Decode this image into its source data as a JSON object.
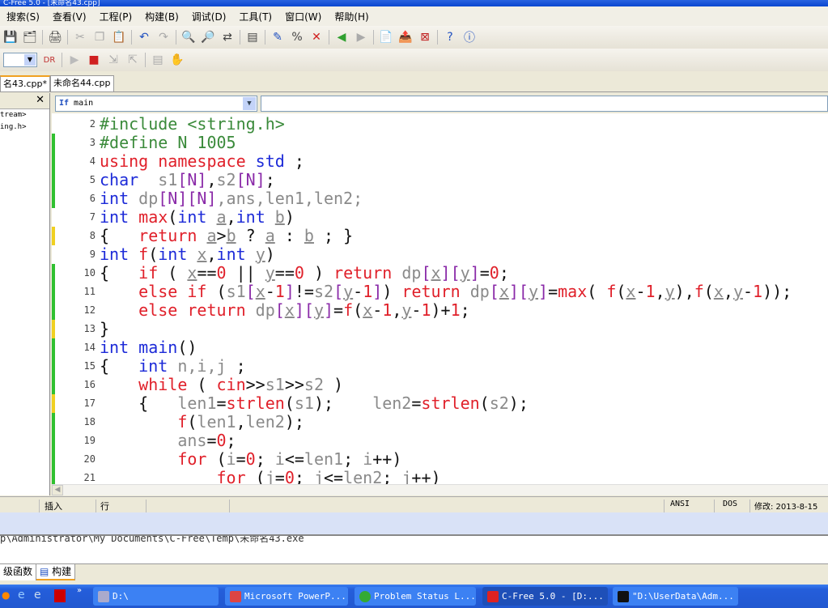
{
  "window": {
    "title": "C-Free 5.0 - [未命名43.cpp]"
  },
  "menu": [
    "搜索(S)",
    "查看(V)",
    "工程(P)",
    "构建(B)",
    "调试(D)",
    "工具(T)",
    "窗口(W)",
    "帮助(H)"
  ],
  "toolbar1": [
    "save-icon",
    "save-all-icon",
    "print-icon",
    "cut-icon",
    "copy-icon",
    "paste-icon",
    "undo-icon",
    "redo-icon",
    "find-icon",
    "find-next-icon",
    "replace-icon",
    "bookmark-icon",
    "compile-icon",
    "run-icon",
    "stop-build-icon",
    "back-icon",
    "forward-icon",
    "file-icon",
    "export-icon",
    "close-file-icon",
    "help-icon",
    "info-icon"
  ],
  "toolbar2": [
    "dropdown",
    "debug-run-icon",
    "play-icon",
    "stop-icon",
    "step-icon",
    "step-over-icon",
    "watch-icon",
    "hand-icon"
  ],
  "tabs": [
    {
      "label": "名43.cpp*",
      "active": true
    },
    {
      "label": "未命名44.cpp",
      "active": false
    }
  ],
  "left_panel": {
    "items": [
      "tream>",
      "ing.h>"
    ]
  },
  "function_selector": {
    "icon": "If",
    "value": "main"
  },
  "editor": {
    "lines": [
      {
        "n": "2",
        "mark": "",
        "t": [
          [
            "#include <string.h>",
            "g"
          ]
        ]
      },
      {
        "n": "3",
        "mark": "green",
        "t": [
          [
            "#define N 1005",
            "g"
          ]
        ]
      },
      {
        "n": "4",
        "mark": "green",
        "t": [
          [
            "using namespace",
            "r"
          ],
          [
            " std",
            "k"
          ],
          [
            " ;",
            "o"
          ]
        ]
      },
      {
        "n": "5",
        "mark": "green",
        "t": [
          [
            "char",
            "k"
          ],
          [
            "  s1",
            "v"
          ],
          [
            "[N]",
            "p"
          ],
          [
            ",",
            "o"
          ],
          [
            "s2",
            "v"
          ],
          [
            "[N]",
            "p"
          ],
          [
            ";",
            "o"
          ]
        ]
      },
      {
        "n": "6",
        "mark": "green",
        "t": [
          [
            "int",
            "k"
          ],
          [
            " dp",
            "v"
          ],
          [
            "[N][N]",
            "p"
          ],
          [
            ",ans,len1,len2;",
            "v"
          ]
        ]
      },
      {
        "n": "7",
        "mark": "",
        "t": [
          [
            "int",
            "k"
          ],
          [
            " max",
            "r"
          ],
          [
            "(",
            "o"
          ],
          [
            "int",
            "k"
          ],
          [
            " ",
            "o"
          ],
          [
            "a",
            "u"
          ],
          [
            ",",
            "o"
          ],
          [
            "int",
            "k"
          ],
          [
            " ",
            "o"
          ],
          [
            "b",
            "u"
          ],
          [
            ")",
            "o"
          ]
        ]
      },
      {
        "n": "8",
        "mark": "yellow",
        "t": [
          [
            "{   ",
            "o"
          ],
          [
            "return",
            "r"
          ],
          [
            " ",
            "o"
          ],
          [
            "a",
            "u"
          ],
          [
            ">",
            "o"
          ],
          [
            "b",
            "u"
          ],
          [
            " ? ",
            "o"
          ],
          [
            "a",
            "u"
          ],
          [
            " : ",
            "o"
          ],
          [
            "b",
            "u"
          ],
          [
            " ; }",
            "o"
          ]
        ]
      },
      {
        "n": "9",
        "mark": "",
        "t": [
          [
            "int",
            "k"
          ],
          [
            " f",
            "r"
          ],
          [
            "(",
            "o"
          ],
          [
            "int",
            "k"
          ],
          [
            " ",
            "o"
          ],
          [
            "x",
            "u"
          ],
          [
            ",",
            "o"
          ],
          [
            "int",
            "k"
          ],
          [
            " ",
            "o"
          ],
          [
            "y",
            "u"
          ],
          [
            ")",
            "o"
          ]
        ]
      },
      {
        "n": "10",
        "mark": "green",
        "t": [
          [
            "{   ",
            "o"
          ],
          [
            "if",
            "r"
          ],
          [
            " ( ",
            "o"
          ],
          [
            "x",
            "u"
          ],
          [
            "==",
            "o"
          ],
          [
            "0",
            "n"
          ],
          [
            " || ",
            "o"
          ],
          [
            "y",
            "u"
          ],
          [
            "==",
            "o"
          ],
          [
            "0",
            "n"
          ],
          [
            " ) ",
            "o"
          ],
          [
            "return",
            "r"
          ],
          [
            " dp",
            "v"
          ],
          [
            "[",
            "p"
          ],
          [
            "x",
            "u"
          ],
          [
            "][",
            "p"
          ],
          [
            "y",
            "u"
          ],
          [
            "]",
            "p"
          ],
          [
            "=",
            "o"
          ],
          [
            "0",
            "n"
          ],
          [
            ";",
            "o"
          ]
        ]
      },
      {
        "n": "11",
        "mark": "green",
        "t": [
          [
            "    ",
            "o"
          ],
          [
            "else if",
            "r"
          ],
          [
            " (",
            "o"
          ],
          [
            "s1",
            "v"
          ],
          [
            "[",
            "p"
          ],
          [
            "x",
            "u"
          ],
          [
            "-",
            "o"
          ],
          [
            "1",
            "n"
          ],
          [
            "]",
            "p"
          ],
          [
            "!=",
            "o"
          ],
          [
            "s2",
            "v"
          ],
          [
            "[",
            "p"
          ],
          [
            "y",
            "u"
          ],
          [
            "-",
            "o"
          ],
          [
            "1",
            "n"
          ],
          [
            "]",
            "p"
          ],
          [
            ") ",
            "o"
          ],
          [
            "return",
            "r"
          ],
          [
            " dp",
            "v"
          ],
          [
            "[",
            "p"
          ],
          [
            "x",
            "u"
          ],
          [
            "][",
            "p"
          ],
          [
            "y",
            "u"
          ],
          [
            "]",
            "p"
          ],
          [
            "=",
            "o"
          ],
          [
            "max",
            "r"
          ],
          [
            "( ",
            "o"
          ],
          [
            "f",
            "r"
          ],
          [
            "(",
            "o"
          ],
          [
            "x",
            "u"
          ],
          [
            "-",
            "o"
          ],
          [
            "1",
            "n"
          ],
          [
            ",",
            "o"
          ],
          [
            "y",
            "u"
          ],
          [
            "),",
            "o"
          ],
          [
            "f",
            "r"
          ],
          [
            "(",
            "o"
          ],
          [
            "x",
            "u"
          ],
          [
            ",",
            "o"
          ],
          [
            "y",
            "u"
          ],
          [
            "-",
            "o"
          ],
          [
            "1",
            "n"
          ],
          [
            "));",
            "o"
          ]
        ]
      },
      {
        "n": "12",
        "mark": "green",
        "t": [
          [
            "    ",
            "o"
          ],
          [
            "else return",
            "r"
          ],
          [
            " dp",
            "v"
          ],
          [
            "[",
            "p"
          ],
          [
            "x",
            "u"
          ],
          [
            "][",
            "p"
          ],
          [
            "y",
            "u"
          ],
          [
            "]",
            "p"
          ],
          [
            "=",
            "o"
          ],
          [
            "f",
            "r"
          ],
          [
            "(",
            "o"
          ],
          [
            "x",
            "u"
          ],
          [
            "-",
            "o"
          ],
          [
            "1",
            "n"
          ],
          [
            ",",
            "o"
          ],
          [
            "y",
            "u"
          ],
          [
            "-",
            "o"
          ],
          [
            "1",
            "n"
          ],
          [
            ")+",
            "o"
          ],
          [
            "1",
            "n"
          ],
          [
            ";",
            "o"
          ]
        ]
      },
      {
        "n": "13",
        "mark": "yellow",
        "t": [
          [
            "}",
            "o"
          ]
        ]
      },
      {
        "n": "14",
        "mark": "green",
        "t": [
          [
            "int",
            "k"
          ],
          [
            " main",
            "k"
          ],
          [
            "()",
            "o"
          ]
        ]
      },
      {
        "n": "15",
        "mark": "green",
        "t": [
          [
            "{   ",
            "o"
          ],
          [
            "int",
            "k"
          ],
          [
            " n,i,j",
            "v"
          ],
          [
            " ;",
            "o"
          ]
        ]
      },
      {
        "n": "16",
        "mark": "green",
        "t": [
          [
            "    ",
            "o"
          ],
          [
            "while",
            "r"
          ],
          [
            " ( ",
            "o"
          ],
          [
            "cin",
            "r"
          ],
          [
            ">>",
            "o"
          ],
          [
            "s1",
            "v"
          ],
          [
            ">>",
            "o"
          ],
          [
            "s2",
            "v"
          ],
          [
            " )",
            "o"
          ]
        ]
      },
      {
        "n": "17",
        "mark": "yellow",
        "t": [
          [
            "    {   ",
            "o"
          ],
          [
            "len1",
            "v"
          ],
          [
            "=",
            "o"
          ],
          [
            "strlen",
            "r"
          ],
          [
            "(",
            "o"
          ],
          [
            "s1",
            "v"
          ],
          [
            ");    ",
            "o"
          ],
          [
            "len2",
            "v"
          ],
          [
            "=",
            "o"
          ],
          [
            "strlen",
            "r"
          ],
          [
            "(",
            "o"
          ],
          [
            "s2",
            "v"
          ],
          [
            ");",
            "o"
          ]
        ]
      },
      {
        "n": "18",
        "mark": "green",
        "t": [
          [
            "        ",
            "o"
          ],
          [
            "f",
            "r"
          ],
          [
            "(",
            "o"
          ],
          [
            "len1",
            "v"
          ],
          [
            ",",
            "o"
          ],
          [
            "len2",
            "v"
          ],
          [
            ");",
            "o"
          ]
        ]
      },
      {
        "n": "19",
        "mark": "green",
        "t": [
          [
            "        ",
            "o"
          ],
          [
            "ans",
            "v"
          ],
          [
            "=",
            "o"
          ],
          [
            "0",
            "n"
          ],
          [
            ";",
            "o"
          ]
        ]
      },
      {
        "n": "20",
        "mark": "green",
        "t": [
          [
            "        ",
            "o"
          ],
          [
            "for",
            "r"
          ],
          [
            " (",
            "o"
          ],
          [
            "i",
            "v"
          ],
          [
            "=",
            "o"
          ],
          [
            "0",
            "n"
          ],
          [
            "; ",
            "o"
          ],
          [
            "i",
            "v"
          ],
          [
            "<=",
            "o"
          ],
          [
            "len1",
            "v"
          ],
          [
            "; ",
            "o"
          ],
          [
            "i",
            "v"
          ],
          [
            "++)",
            "o"
          ]
        ]
      },
      {
        "n": "21",
        "mark": "green",
        "t": [
          [
            "            ",
            "o"
          ],
          [
            "for",
            "r"
          ],
          [
            " (",
            "o"
          ],
          [
            "j",
            "v"
          ],
          [
            "=",
            "o"
          ],
          [
            "0",
            "n"
          ],
          [
            "; ",
            "o"
          ],
          [
            "j",
            "v"
          ],
          [
            "<=",
            "o"
          ],
          [
            "len2",
            "v"
          ],
          [
            "; ",
            "o"
          ],
          [
            "j",
            "v"
          ],
          [
            "++)",
            "o"
          ]
        ]
      }
    ]
  },
  "status": {
    "insert": "插入",
    "row": "行",
    "encoding": "ANSI",
    "line_ending": "DOS",
    "modified": "修改: 2013-8-15"
  },
  "output": {
    "text": "p\\Administrator\\My Documents\\C-Free\\Temp\\未命名43.exe"
  },
  "bottom_tabs": [
    {
      "label": "级函数"
    },
    {
      "label": "构建",
      "active": true
    }
  ],
  "taskbar": {
    "items": [
      "D:\\",
      "Microsoft PowerP...",
      "Problem Status L...",
      "C-Free 5.0 - [D:...",
      "\"D:\\UserData\\Adm..."
    ]
  },
  "colors": {
    "keyword": "#1c2ad8",
    "red": "#e0202a",
    "preprocessor": "#3a8a3a",
    "identifier": "#8a8a8a",
    "bracket": "#8a2aa8",
    "taskbar": "#245edb"
  }
}
